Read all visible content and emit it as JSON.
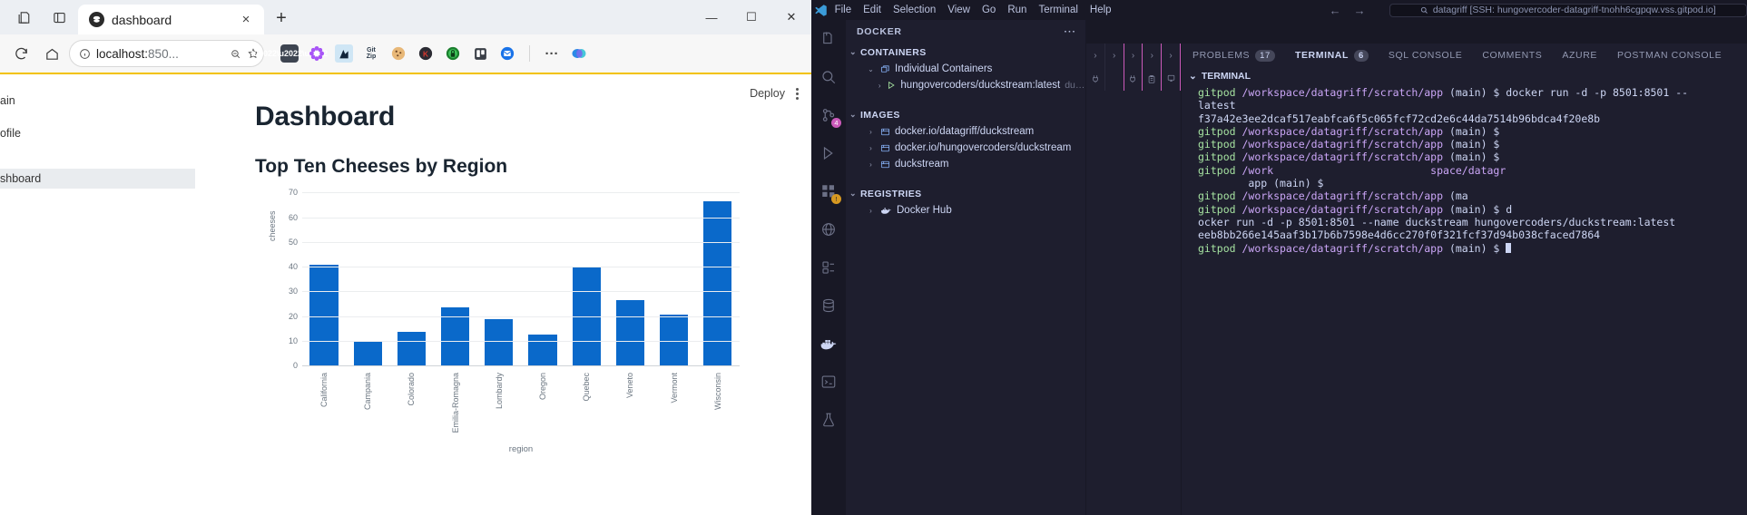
{
  "browser": {
    "tab": {
      "title": "dashboard",
      "close_label": "×"
    },
    "newtab_label": "+",
    "window": {
      "minimize": "—",
      "maximize": "☐",
      "close": "✕"
    },
    "toolbar_icons": [
      "collections-icon",
      "split-screen-icon"
    ],
    "nav": {
      "reload": "reload-icon",
      "home": "home-icon"
    },
    "omnibox": {
      "info_icon": "info-icon",
      "url_prefix": "localhost:",
      "url_suffix": "850...",
      "zoom_icon": "zoom-out-icon",
      "favorite_icon": "star-icon"
    },
    "extensions": [
      "extension-dots-icon",
      "settings-flower-icon",
      "keeper-icon",
      "gitzip-icon",
      "cookie-icon",
      "kaspersky-icon",
      "lastpass-icon",
      "trello-icon",
      "outlook-icon"
    ],
    "more_label": "···",
    "copilot_icon": "copilot-icon"
  },
  "page": {
    "sidebar": [
      {
        "label": "ain",
        "active": false
      },
      {
        "label": "ofile",
        "active": false
      },
      {
        "label": "shboard",
        "active": true
      }
    ],
    "deploy_label": "Deploy",
    "menu_icon": "kebab-menu-icon",
    "title": "Dashboard"
  },
  "chart_data": {
    "type": "bar",
    "title": "Top Ten Cheeses by Region",
    "xlabel": "region",
    "ylabel": "cheeses",
    "categories": [
      "California",
      "Campania",
      "Colorado",
      "Emilia-Romagna",
      "Lombardy",
      "Oregon",
      "Quebec",
      "Veneto",
      "Vermont",
      "Wisconsin"
    ],
    "values": [
      41,
      10,
      14,
      24,
      19,
      13,
      40,
      27,
      21,
      67
    ],
    "yticks": [
      0,
      10,
      20,
      30,
      40,
      50,
      60,
      70
    ],
    "ylim": [
      0,
      72
    ],
    "grid": true,
    "legend": false,
    "bar_color": "#0a69ca"
  },
  "vscode": {
    "titlebar": {
      "menus": [
        "File",
        "Edit",
        "Selection",
        "View",
        "Go",
        "Run",
        "Terminal",
        "Help"
      ],
      "back_icon": "arrow-left-icon",
      "forward_icon": "arrow-right-icon",
      "search_icon": "search-icon",
      "search_text": "datagriff [SSH: hungovercoder-datagriff-tnohh6cgpqw.vss.gitpod.io]"
    },
    "activitybar": [
      {
        "name": "explorer-icon",
        "badge": ""
      },
      {
        "name": "search-icon",
        "badge": ""
      },
      {
        "name": "source-control-icon",
        "badge": "4"
      },
      {
        "name": "run-debug-icon",
        "badge": ""
      },
      {
        "name": "extensions-icon",
        "badge": "!"
      },
      {
        "name": "remote-explorer-icon",
        "badge": ""
      },
      {
        "name": "testing-icon",
        "badge": ""
      },
      {
        "name": "database-icon",
        "badge": ""
      },
      {
        "name": "docker-icon",
        "badge": ""
      },
      {
        "name": "terminal-panel-icon",
        "badge": ""
      },
      {
        "name": "beaker-icon",
        "badge": ""
      }
    ],
    "docker_panel": {
      "title": "DOCKER",
      "more_icon": "more-actions-icon",
      "sections": [
        {
          "title": "CONTAINERS",
          "rows": [
            {
              "indent": 2,
              "chevron": "⌄",
              "icon": "containers-group-icon",
              "label": "Individual Containers",
              "sub": ""
            },
            {
              "indent": 3,
              "chevron": "›",
              "icon": "play-icon",
              "label": "hungovercoders/duckstream:latest",
              "sub": "duckst..."
            }
          ]
        },
        {
          "title": "IMAGES",
          "rows": [
            {
              "indent": 2,
              "chevron": "›",
              "icon": "image-icon",
              "label": "docker.io/datagriff/duckstream",
              "sub": ""
            },
            {
              "indent": 2,
              "chevron": "›",
              "icon": "image-icon",
              "label": "docker.io/hungovercoders/duckstream",
              "sub": ""
            },
            {
              "indent": 2,
              "chevron": "›",
              "icon": "image-icon",
              "label": "duckstream",
              "sub": ""
            }
          ]
        },
        {
          "title": "REGISTRIES",
          "rows": [
            {
              "indent": 2,
              "chevron": "›",
              "icon": "docker-whale-icon",
              "label": "Docker Hub",
              "sub": ""
            }
          ]
        }
      ]
    },
    "panel_tabs": [
      {
        "label": "PROBLEMS",
        "count": "17",
        "active": false
      },
      {
        "label": "TERMINAL",
        "count": "6",
        "active": true
      },
      {
        "label": "SQL CONSOLE",
        "count": "",
        "active": false
      },
      {
        "label": "COMMENTS",
        "count": "",
        "active": false
      },
      {
        "label": "AZURE",
        "count": "",
        "active": false
      },
      {
        "label": "POSTMAN CONSOLE",
        "count": "",
        "active": false
      }
    ],
    "terminal": {
      "header": "TERMINAL",
      "chevron": "⌄",
      "lines": [
        [
          {
            "t": "gitpod ",
            "c": "g"
          },
          {
            "t": "/workspace/datagriff/scratch/app ",
            "c": "p"
          },
          {
            "t": "(main) $ docker run -d -p 8501:8501 --",
            "c": "w"
          }
        ],
        [
          {
            "t": "latest",
            "c": "w"
          }
        ],
        [
          {
            "t": "f37a42e3ee2dcaf517eabfca6f5c065fcf72cd2e6c44da7514b96bdca4f20e8b",
            "c": "w"
          }
        ],
        [
          {
            "t": "gitpod ",
            "c": "g"
          },
          {
            "t": "/workspace/datagriff/scratch/app ",
            "c": "p"
          },
          {
            "t": "(main) $",
            "c": "w"
          }
        ],
        [
          {
            "t": "gitpod ",
            "c": "g"
          },
          {
            "t": "/workspace/datagriff/scratch/app ",
            "c": "p"
          },
          {
            "t": "(main) $",
            "c": "w"
          }
        ],
        [
          {
            "t": "gitpod ",
            "c": "g"
          },
          {
            "t": "/workspace/datagriff/scratch/app ",
            "c": "p"
          },
          {
            "t": "(main) $",
            "c": "w"
          }
        ],
        [
          {
            "t": "gitpod ",
            "c": "g"
          },
          {
            "t": "/work",
            "c": "p"
          },
          {
            "t": "                         space/datagr",
            "c": "p"
          }
        ],
        [
          {
            "t": "        app ",
            "c": "w"
          },
          {
            "t": "(main) $",
            "c": "w"
          }
        ],
        [
          {
            "t": "gitpod ",
            "c": "g"
          },
          {
            "t": "/workspace/datagriff/scratch/app ",
            "c": "p"
          },
          {
            "t": "(ma",
            "c": "w"
          }
        ],
        [
          {
            "t": "gitpod ",
            "c": "g"
          },
          {
            "t": "/workspace/datagriff/scratch/app ",
            "c": "p"
          },
          {
            "t": "(main) $ d",
            "c": "w"
          }
        ],
        [
          {
            "t": "ocker run -d -p 8501:8501 --name duckstream hungovercoders/duckstream:latest",
            "c": "w"
          }
        ],
        [
          {
            "t": "eeb8bb266e145aaf3b17b6b7598e4d6cc270f0f321fcf37d94b038cfaced7864",
            "c": "w"
          }
        ],
        [
          {
            "t": "gitpod ",
            "c": "g"
          },
          {
            "t": "/workspace/datagriff/scratch/app ",
            "c": "p"
          },
          {
            "t": "(main) $ ",
            "c": "w"
          },
          {
            "t": "█",
            "c": "cur"
          }
        ]
      ]
    }
  }
}
